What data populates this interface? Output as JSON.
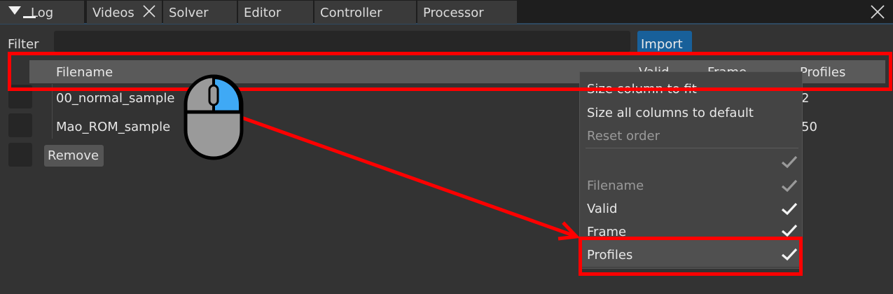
{
  "tabs": [
    {
      "label": "Log"
    },
    {
      "label": "Videos"
    },
    {
      "label": "Solver"
    },
    {
      "label": "Editor"
    },
    {
      "label": "Controller"
    },
    {
      "label": "Processor"
    }
  ],
  "filter": {
    "label": "Filter",
    "value": ""
  },
  "import_label": "Import",
  "table": {
    "headers": [
      "Filename",
      "Valid",
      "Frame",
      "Profiles"
    ],
    "rows": [
      {
        "filename": "00_normal_sample",
        "profiles": "2"
      },
      {
        "filename": "Mao_ROM_sample",
        "profiles": "50"
      }
    ]
  },
  "remove_label": "Remove",
  "context_menu": {
    "items": [
      {
        "label": "Size column to fit"
      },
      {
        "label": "Size all columns to default"
      },
      {
        "label": "Reset order"
      },
      {
        "label": ""
      },
      {
        "label": "Filename"
      },
      {
        "label": "Valid"
      },
      {
        "label": "Frame"
      },
      {
        "label": "Profiles"
      }
    ]
  },
  "colors": {
    "accent": "#18609a",
    "annotation": "#ff0000",
    "mouse_button": "#3fa9f5"
  }
}
